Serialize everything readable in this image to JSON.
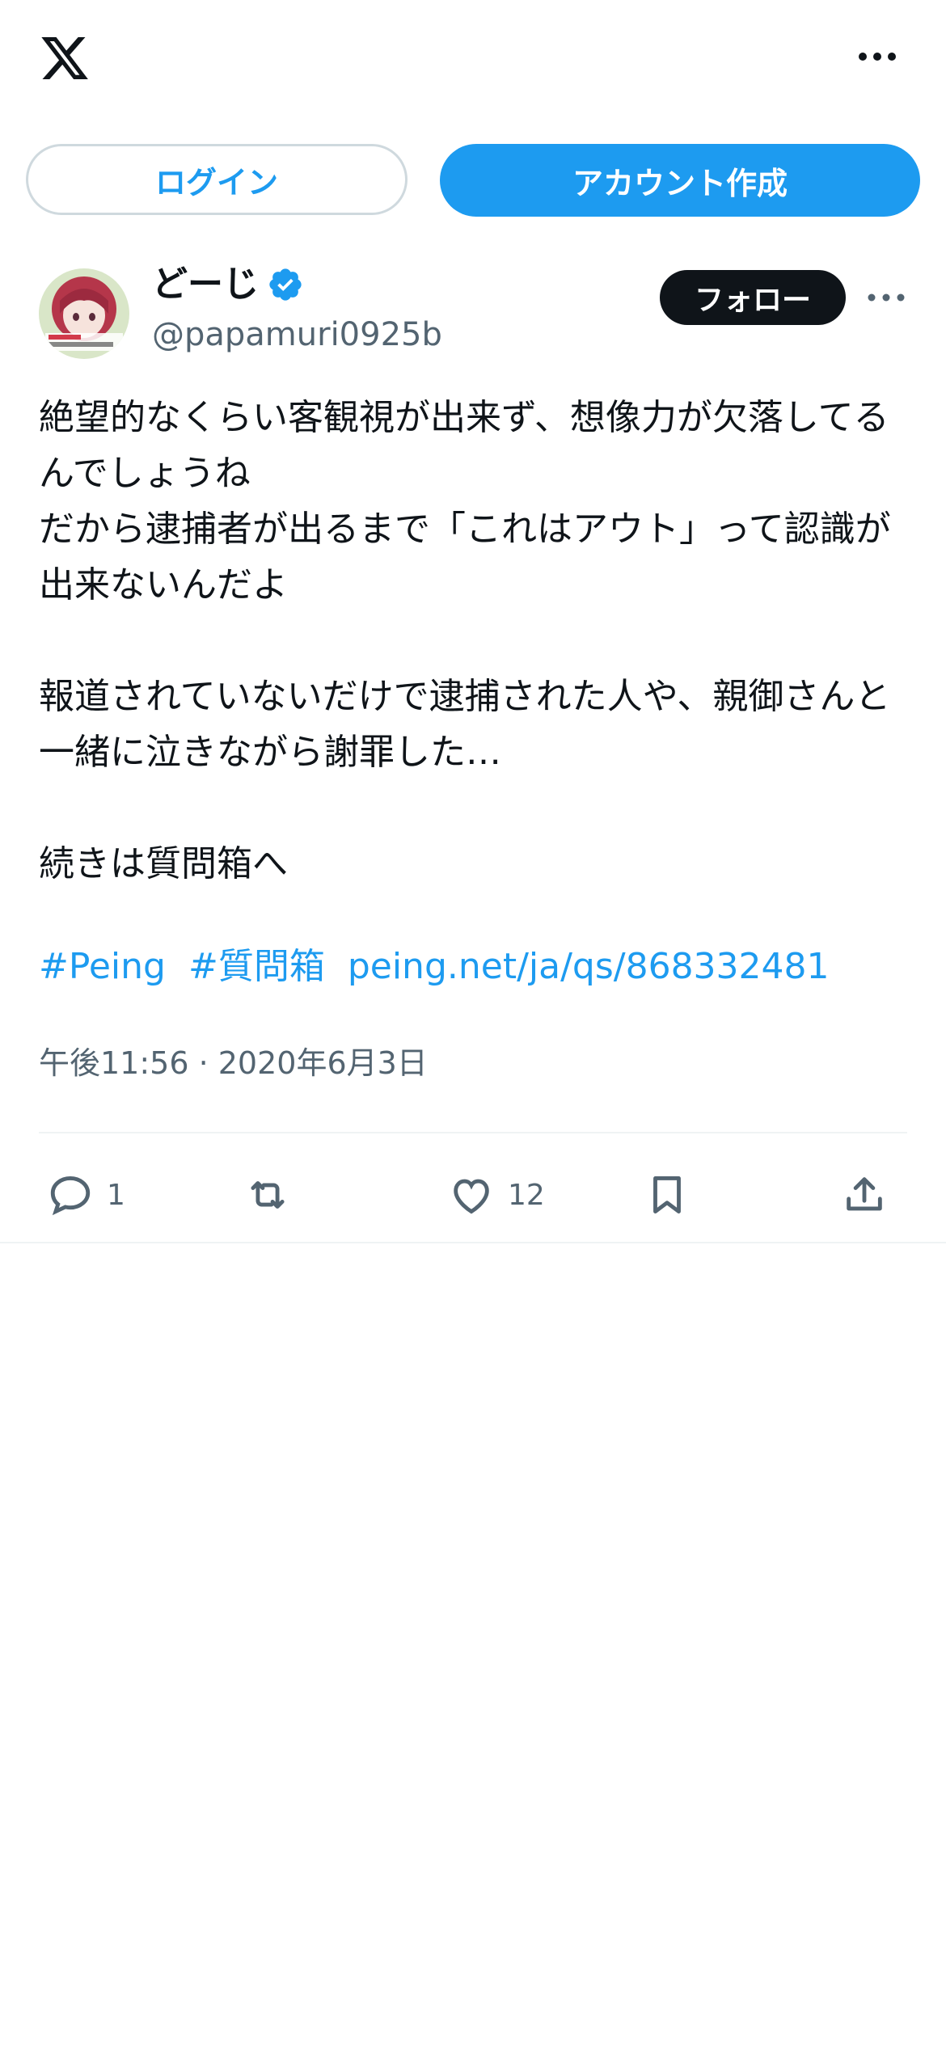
{
  "header": {
    "logo_icon": "x-logo-icon",
    "more_icon": "more-horizontal-icon"
  },
  "auth": {
    "login_label": "ログイン",
    "signup_label": "アカウント作成"
  },
  "tweet": {
    "author": {
      "display_name": "どーじ",
      "handle": "@papamuri0925b",
      "verified": true
    },
    "follow_label": "フォロー",
    "text_paragraphs": [
      "絶望的なくらい客観視が出来ず、想像力が欠落してるんでしょうね\nだから逮捕者が出るまで「これはアウト」って認識が出来ないんだよ",
      "報道されていないだけで逮捕された人や、親御さんと一緒に泣きながら謝罪した…",
      "続きは質問箱へ"
    ],
    "links": [
      "#Peing",
      "#質問箱",
      "peing.net/ja/qs/868332481"
    ],
    "timestamp": "午後11:56 · 2020年6月3日",
    "stats": {
      "replies": "1",
      "reposts": "",
      "likes": "12"
    }
  },
  "colors": {
    "accent": "#1d9bf0",
    "text_primary": "#0f1419",
    "text_secondary": "#536471",
    "border": "#cfd9de",
    "divider": "#eff3f4"
  }
}
